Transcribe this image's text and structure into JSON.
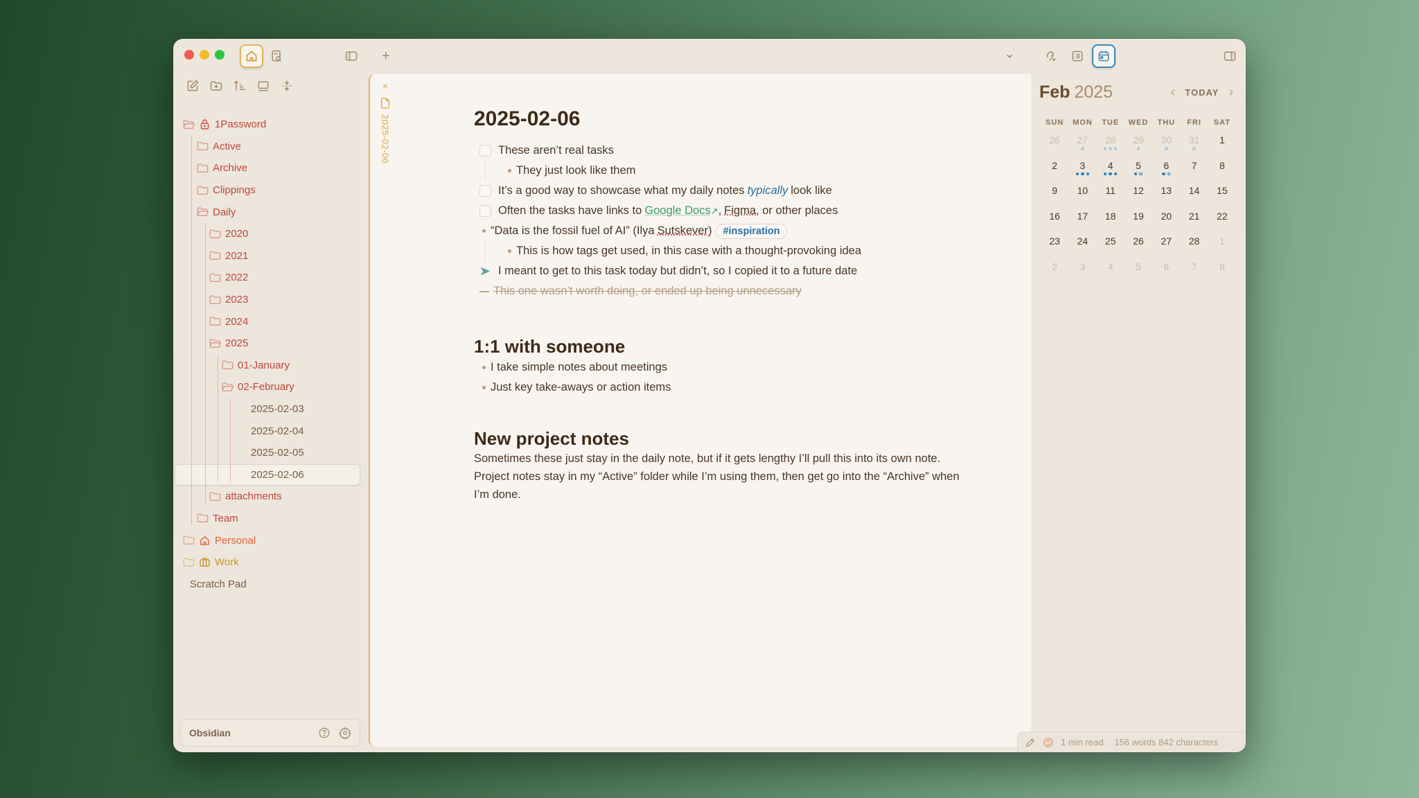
{
  "app": {
    "vault_name": "Obsidian"
  },
  "titlebar": {
    "icons": [
      "home-icon",
      "search-note-icon",
      "sidebar-toggle-icon",
      "new-tab-icon",
      "chevron-down-icon",
      "link-graph-icon",
      "outline-icon",
      "calendar-icon",
      "right-sidebar-icon"
    ],
    "new_tab_symbol": "+"
  },
  "sidebar": {
    "toolbar": [
      "new-note-icon",
      "new-folder-icon",
      "sort-icon",
      "collapse-view-icon",
      "collapse-all-icon"
    ],
    "tree": [
      {
        "label": "1Password",
        "type": "folder",
        "open": true,
        "icon": "lock-icon",
        "depth": 0
      },
      {
        "label": "Active",
        "type": "folder",
        "depth": 1
      },
      {
        "label": "Archive",
        "type": "folder",
        "depth": 1
      },
      {
        "label": "Clippings",
        "type": "folder",
        "depth": 1
      },
      {
        "label": "Daily",
        "type": "folder",
        "open": true,
        "depth": 1
      },
      {
        "label": "2020",
        "type": "folder",
        "depth": 2
      },
      {
        "label": "2021",
        "type": "folder",
        "depth": 2
      },
      {
        "label": "2022",
        "type": "folder",
        "depth": 2
      },
      {
        "label": "2023",
        "type": "folder",
        "depth": 2
      },
      {
        "label": "2024",
        "type": "folder",
        "depth": 2
      },
      {
        "label": "2025",
        "type": "folder",
        "open": true,
        "depth": 2
      },
      {
        "label": "01-January",
        "type": "folder",
        "depth": 3
      },
      {
        "label": "02-February",
        "type": "folder",
        "open": true,
        "depth": 3
      },
      {
        "label": "2025-02-03",
        "type": "file",
        "depth": 4
      },
      {
        "label": "2025-02-04",
        "type": "file",
        "depth": 4
      },
      {
        "label": "2025-02-05",
        "type": "file",
        "depth": 4
      },
      {
        "label": "2025-02-06",
        "type": "file",
        "depth": 4,
        "selected": true
      },
      {
        "label": "attachments",
        "type": "folder",
        "depth": 2
      },
      {
        "label": "Team",
        "type": "folder",
        "depth": 1
      },
      {
        "label": "Personal",
        "type": "folder",
        "icon": "home-icon",
        "depth": 0,
        "color": "#e2633a"
      },
      {
        "label": "Work",
        "type": "folder",
        "icon": "briefcase-icon",
        "depth": 0,
        "color": "#c9952c"
      },
      {
        "label": "Scratch Pad",
        "type": "plain",
        "depth": 0
      }
    ],
    "footer": {
      "vault": "Obsidian",
      "help_icon": "help-icon",
      "settings_icon": "gear-icon"
    }
  },
  "editor": {
    "tab": {
      "title": "2025-02-06",
      "close": "×"
    },
    "title": "2025-02-06",
    "tasks": [
      {
        "text": "These aren’t real tasks"
      },
      {
        "sub": "They just look like them"
      },
      {
        "pre": "It’s a good way to showcase what my daily notes",
        "em": "typically",
        "post": "look like"
      },
      {
        "pre": "Often the tasks have links to",
        "link1": "Google Docs",
        "link1_arrow": "↗",
        "sep": ",",
        "link2": "Figma",
        "post": ", or other places"
      },
      {
        "quote": "“Data is the fossil fuel of AI” (Ilya",
        "quote_name": "Sutskever",
        "quote_end": ")",
        "tag": "#inspiration"
      },
      {
        "sub": "This is how tags get used, in this case with a thought-provoking idea"
      },
      {
        "forwarded": "I meant to get to this task today but didn’t, so I copied it to a future date"
      },
      {
        "cancelled": "This one wasn’t worth doing, or ended up being unnecessary"
      }
    ],
    "section2": {
      "heading": "1:1 with someone",
      "bullets": [
        "I take simple notes about meetings",
        "Just key take-aways or action items"
      ]
    },
    "section3": {
      "heading": "New project notes",
      "paragraph": "Sometimes these just stay in the daily note, but if it gets lengthy I’ll pull this into its own note. Project notes stay in my “Active” folder while I’m using them, then get go into the “Archive” when I’m done."
    }
  },
  "calendar": {
    "month": "Feb",
    "year": "2025",
    "today_label": "TODAY",
    "prev": "‹",
    "next": "›",
    "weekdays": [
      "SUN",
      "MON",
      "TUE",
      "WED",
      "THU",
      "FRI",
      "SAT"
    ],
    "days": [
      {
        "d": "26",
        "other": true
      },
      {
        "d": "27",
        "other": true,
        "dots": [
          "faded"
        ]
      },
      {
        "d": "28",
        "other": true,
        "dots": [
          "faded",
          "faded",
          "faded"
        ]
      },
      {
        "d": "29",
        "other": true,
        "dots": [
          "faded"
        ]
      },
      {
        "d": "30",
        "other": true,
        "dots": [
          "faded"
        ]
      },
      {
        "d": "31",
        "other": true,
        "dots": [
          "faded"
        ]
      },
      {
        "d": "1"
      },
      {
        "d": "2"
      },
      {
        "d": "3",
        "dots": [
          "solid",
          "solid",
          "solid"
        ]
      },
      {
        "d": "4",
        "dots": [
          "solid",
          "solid",
          "solid"
        ]
      },
      {
        "d": "5",
        "boxed": true,
        "dots": [
          "solid",
          "ring"
        ]
      },
      {
        "d": "6",
        "boxed": true,
        "today": true,
        "dots": [
          "solid",
          "ring"
        ]
      },
      {
        "d": "7"
      },
      {
        "d": "8"
      },
      {
        "d": "9"
      },
      {
        "d": "10"
      },
      {
        "d": "11"
      },
      {
        "d": "12"
      },
      {
        "d": "13"
      },
      {
        "d": "14"
      },
      {
        "d": "15"
      },
      {
        "d": "16"
      },
      {
        "d": "17"
      },
      {
        "d": "18"
      },
      {
        "d": "19"
      },
      {
        "d": "20"
      },
      {
        "d": "21"
      },
      {
        "d": "22"
      },
      {
        "d": "23"
      },
      {
        "d": "24"
      },
      {
        "d": "25"
      },
      {
        "d": "26"
      },
      {
        "d": "27"
      },
      {
        "d": "28"
      },
      {
        "d": "1",
        "other": true
      },
      {
        "d": "2",
        "other": true
      },
      {
        "d": "3",
        "other": true
      },
      {
        "d": "4",
        "other": true
      },
      {
        "d": "5",
        "other": true
      },
      {
        "d": "6",
        "other": true
      },
      {
        "d": "7",
        "other": true
      },
      {
        "d": "8",
        "other": true
      }
    ]
  },
  "status": {
    "read_time": "1 min read",
    "counts": "156 words 842 characters"
  }
}
